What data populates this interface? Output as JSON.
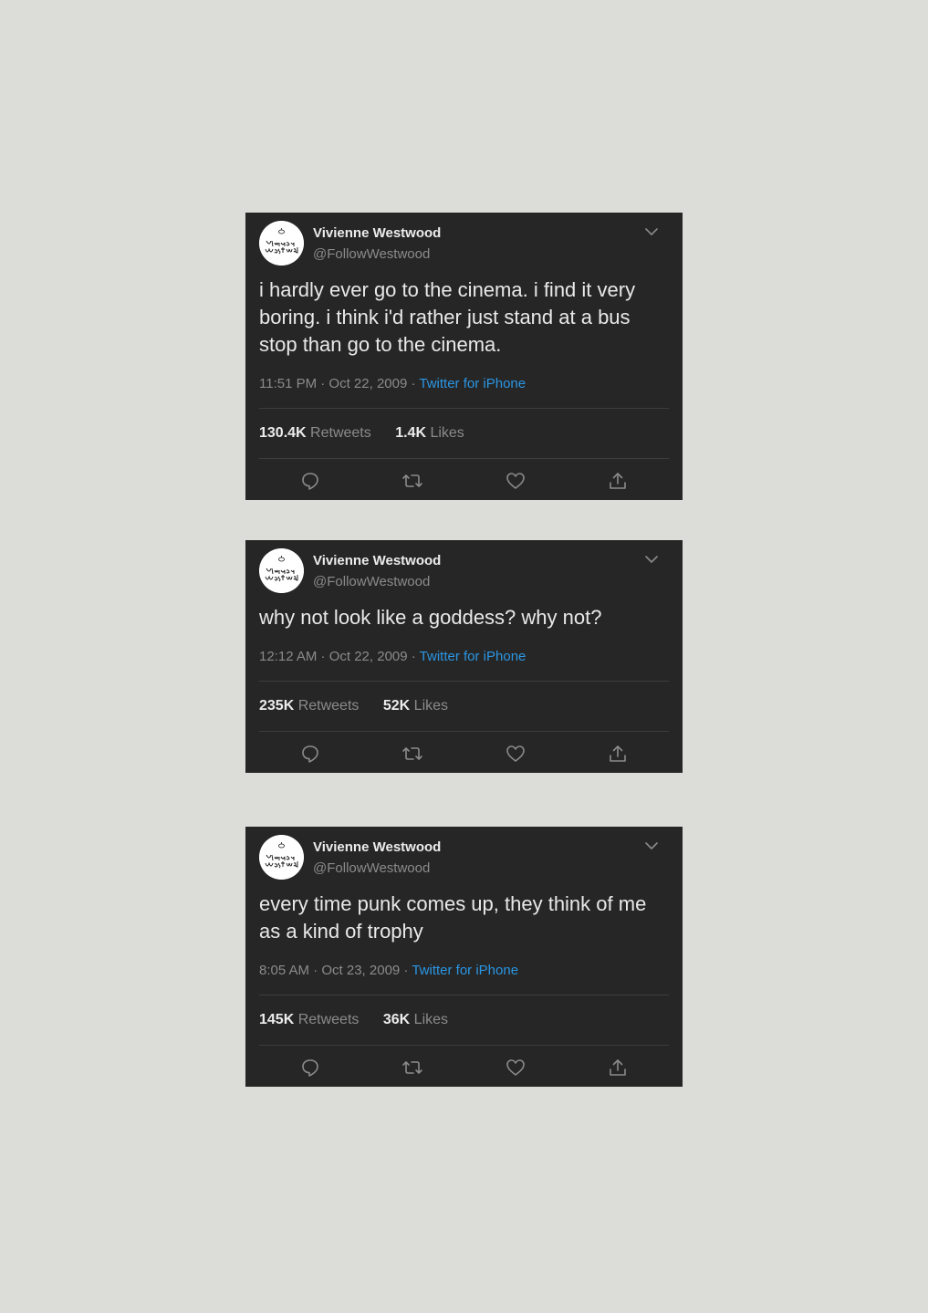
{
  "colors": {
    "page_background": "#dcdcd8",
    "card_background": "#262626",
    "link": "#2a96e4",
    "muted": "#8b8b8b"
  },
  "tweets": [
    {
      "display_name": "Vivienne Westwood",
      "handle": "@FollowWestwood",
      "avatar_logo_text": "Vivienne Westwood",
      "text": "i hardly ever go to the cinema. i find it very boring. i think i'd rather just stand at a bus stop than go to the cinema.",
      "time": "11:51 PM · Oct 22, 2009 · ",
      "source": "Twitter for iPhone",
      "retweets_count": "130.4K",
      "retweets_label": "Retweets",
      "likes_count": "1.4K",
      "likes_label": "Likes",
      "icons": [
        "chevron-down-icon",
        "reply-icon",
        "retweet-icon",
        "like-icon",
        "share-icon"
      ]
    },
    {
      "display_name": "Vivienne Westwood",
      "handle": "@FollowWestwood",
      "avatar_logo_text": "Vivienne Westwood",
      "text": "why not look like a goddess? why not?",
      "time": "12:12 AM · Oct 22, 2009 · ",
      "source": "Twitter for iPhone",
      "retweets_count": "235K",
      "retweets_label": "Retweets",
      "likes_count": "52K",
      "likes_label": "Likes",
      "icons": [
        "chevron-down-icon",
        "reply-icon",
        "retweet-icon",
        "like-icon",
        "share-icon"
      ]
    },
    {
      "display_name": "Vivienne Westwood",
      "handle": "@FollowWestwood",
      "avatar_logo_text": "Vivienne Westwood",
      "text": "every time punk comes up, they think of me as a kind of trophy",
      "time": "8:05 AM · Oct 23, 2009 · ",
      "source": "Twitter for iPhone",
      "retweets_count": "145K",
      "retweets_label": "Retweets",
      "likes_count": "36K",
      "likes_label": "Likes",
      "icons": [
        "chevron-down-icon",
        "reply-icon",
        "retweet-icon",
        "like-icon",
        "share-icon"
      ]
    }
  ]
}
